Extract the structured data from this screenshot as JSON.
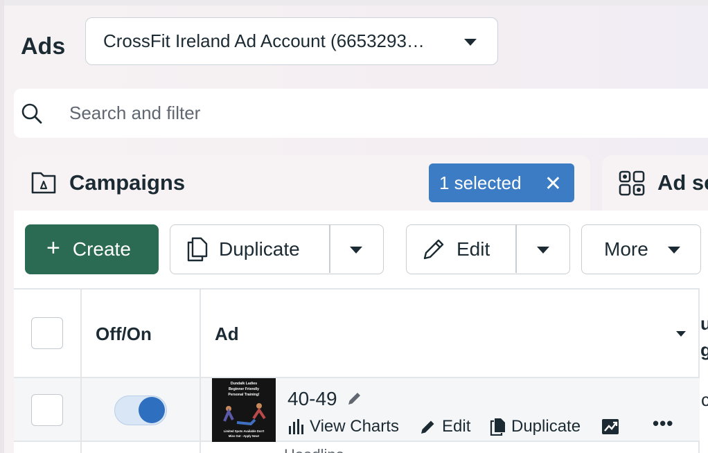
{
  "header": {
    "title": "Ads"
  },
  "account_select": {
    "value": "CrossFit Ireland Ad Account (6653293…"
  },
  "search": {
    "placeholder": "Search and filter"
  },
  "campaigns_panel": {
    "title": "Campaigns",
    "selected_chip": "1 selected",
    "close_glyph": "✕"
  },
  "adsets_panel": {
    "title_partial": "Ad se"
  },
  "toolbar": {
    "create_label": "Create",
    "plus_glyph": "+",
    "duplicate_label": "Duplicate",
    "edit_label": "Edit",
    "more_label": "More"
  },
  "table": {
    "columns": {
      "toggle": "Off/On",
      "ad": "Ad",
      "next_partial_top": "u",
      "next_partial_bottom": "g"
    },
    "rows": [
      {
        "name": "40-49",
        "toggle_on": true,
        "actions": {
          "view_charts": "View Charts",
          "edit": "Edit",
          "duplicate": "Duplicate",
          "more": "•••"
        },
        "next_col_partial": "c",
        "thumbnail_text": {
          "line1": "Dundalk Ladies",
          "line2": "Beginner Friendly",
          "line3": "Personal Training!",
          "line4": "Limited Spots Available Don't",
          "line5": "Miss Out - Apply Now!"
        }
      }
    ],
    "next_row_partial": "Headline"
  },
  "colors": {
    "create": "#2b6b53",
    "chip": "#3b7cc4",
    "toggle_knob": "#2f6fc0"
  },
  "icons": [
    "search-icon",
    "folder-icon",
    "close-icon",
    "grid-icon",
    "plus-icon",
    "duplicate-icon",
    "pencil-icon",
    "chevron-down-icon",
    "bar-chart-icon",
    "trend-chart-icon",
    "more-icon"
  ]
}
